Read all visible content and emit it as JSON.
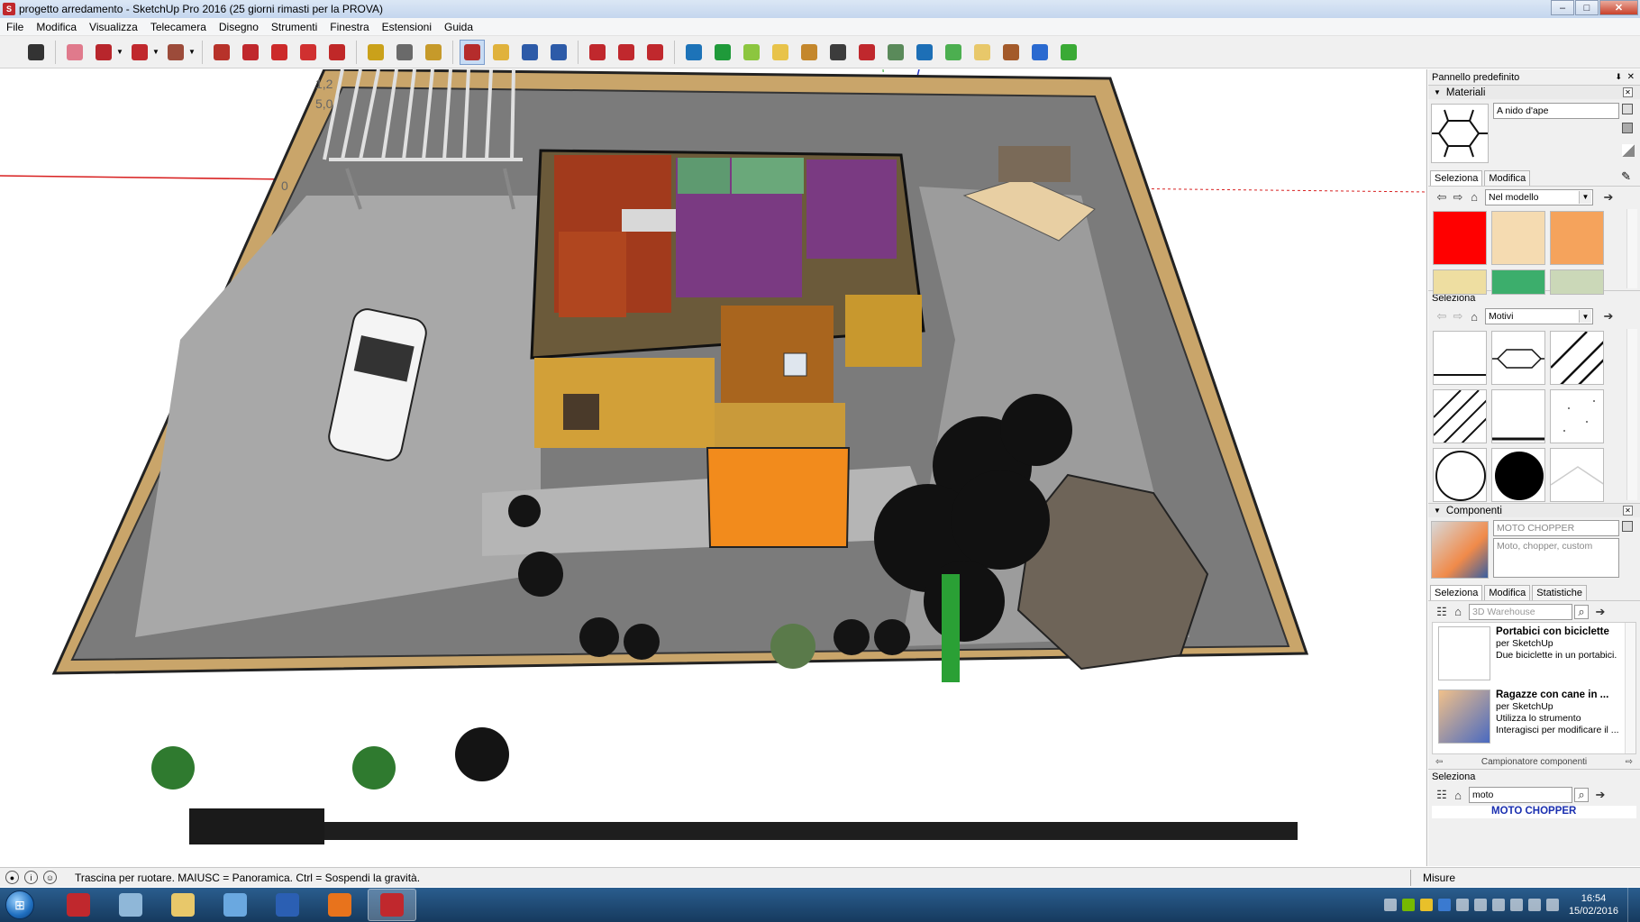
{
  "window": {
    "title": "progetto arredamento - SketchUp Pro 2016 (25 giorni rimasti per la PROVA)"
  },
  "menu": [
    "File",
    "Modifica",
    "Visualizza",
    "Telecamera",
    "Disegno",
    "Strumenti",
    "Finestra",
    "Estensioni",
    "Guida"
  ],
  "toolbar": {
    "tools": [
      {
        "name": "select-tool",
        "color": "#333333"
      },
      {
        "name": "eraser-tool",
        "color": "#e07a8c"
      },
      {
        "name": "line-tool",
        "color": "#b8262c"
      },
      {
        "name": "arc-tool",
        "color": "#c0282d"
      },
      {
        "name": "rectangle-tool",
        "color": "#9c4b3a"
      },
      {
        "name": "push-pull-tool",
        "color": "#b7322a"
      },
      {
        "name": "follow-me-tool",
        "color": "#c0282d"
      },
      {
        "name": "move-tool",
        "color": "#cc2a2a"
      },
      {
        "name": "rotate-tool",
        "color": "#d03030"
      },
      {
        "name": "scale-tool",
        "color": "#c02828"
      },
      {
        "name": "tape-measure-tool",
        "color": "#caa11a"
      },
      {
        "name": "text-tool",
        "color": "#6a6a6a"
      },
      {
        "name": "paint-bucket-tool",
        "color": "#c69a2a"
      },
      {
        "name": "orbit-tool",
        "color": "#b52c2c"
      },
      {
        "name": "pan-tool",
        "color": "#e0b23c"
      },
      {
        "name": "zoom-tool",
        "color": "#2d5ba8"
      },
      {
        "name": "zoom-extents-tool",
        "color": "#2d5ba8"
      },
      {
        "name": "previous-view-tool",
        "color": "#c0282d"
      },
      {
        "name": "next-view-tool",
        "color": "#c0282d"
      },
      {
        "name": "warehouse-tool",
        "color": "#c0282d"
      },
      {
        "name": "extension-warehouse-tool",
        "color": "#1d73b8"
      },
      {
        "name": "geo-location-tool",
        "color": "#1f9a3a"
      },
      {
        "name": "sandbox-tool",
        "color": "#8cc63f"
      },
      {
        "name": "clipboard-tool",
        "color": "#e8c34a"
      },
      {
        "name": "section-tool",
        "color": "#c4872c"
      },
      {
        "name": "flashlight-tool",
        "color": "#3c3c3c"
      },
      {
        "name": "layers-tool",
        "color": "#c0282d"
      },
      {
        "name": "components-tool",
        "color": "#5a8a5a"
      },
      {
        "name": "scenes-tool",
        "color": "#1d6fb6"
      },
      {
        "name": "styles-tool",
        "color": "#4caf50"
      },
      {
        "name": "folder-tool",
        "color": "#e8c86a"
      },
      {
        "name": "film-tool",
        "color": "#a35a2a"
      },
      {
        "name": "layout-tool",
        "color": "#2a6ad0"
      },
      {
        "name": "help-tool",
        "color": "#3aaa35"
      }
    ],
    "active_index": 13
  },
  "viewport": {
    "dimension_labels": [
      "1,2",
      "5,0",
      "0"
    ],
    "ground_color": "#7b7b7b",
    "wall_color": "#c9a56a"
  },
  "panel": {
    "title": "Pannello predefinito",
    "materials": {
      "header": "Materiali",
      "current_material": "A nido d'ape",
      "tabs": [
        "Seleziona",
        "Modifica"
      ],
      "library": "Nel modello",
      "swatches": [
        "#ff0000",
        "#f5dbb1",
        "#f5a35c",
        "#eedea1",
        "#3cae6c",
        "#cbd8b8"
      ],
      "subheader": "Seleziona",
      "pattern_library": "Motivi",
      "patterns": [
        "line",
        "honeycomb",
        "diagonal",
        "diagonal-wide",
        "bottom-line",
        "noise",
        "circle",
        "filled-circle",
        "chevron"
      ]
    },
    "components": {
      "header": "Componenti",
      "current_name": "MOTO CHOPPER",
      "current_desc": "Moto, chopper, custom",
      "tabs": [
        "Seleziona",
        "Modifica",
        "Statistiche"
      ],
      "search_placeholder": "3D Warehouse",
      "items": [
        {
          "title": "Portabici con biciclette",
          "author": "per SketchUp",
          "desc1": "Due biciclette in un portabici.",
          "desc2": ""
        },
        {
          "title": "Ragazze con cane in ...",
          "author": "per SketchUp",
          "desc1": "Utilizza lo strumento",
          "desc2": "Interagisci per modificare il ..."
        }
      ],
      "sampler": "Campionatore componenti",
      "subheader": "Seleziona",
      "search2_value": "moto",
      "result_title": "MOTO CHOPPER"
    }
  },
  "statusbar": {
    "message": "Trascina per ruotare. MAIUSC = Panoramica. Ctrl = Sospendi la gravità.",
    "measure_label": "Misure"
  },
  "taskbar": {
    "apps": [
      {
        "name": "acrobat-icon",
        "color": "#c0282d"
      },
      {
        "name": "calculator-icon",
        "color": "#8fb7d8"
      },
      {
        "name": "explorer-icon",
        "color": "#e8c86a"
      },
      {
        "name": "paint-icon",
        "color": "#6aa8e0"
      },
      {
        "name": "word-icon",
        "color": "#2b5fb3"
      },
      {
        "name": "firefox-icon",
        "color": "#e8731c"
      },
      {
        "name": "sketchup-icon",
        "color": "#c0282d"
      }
    ],
    "active_app": 6,
    "time": "16:54",
    "date": "15/02/2016"
  }
}
